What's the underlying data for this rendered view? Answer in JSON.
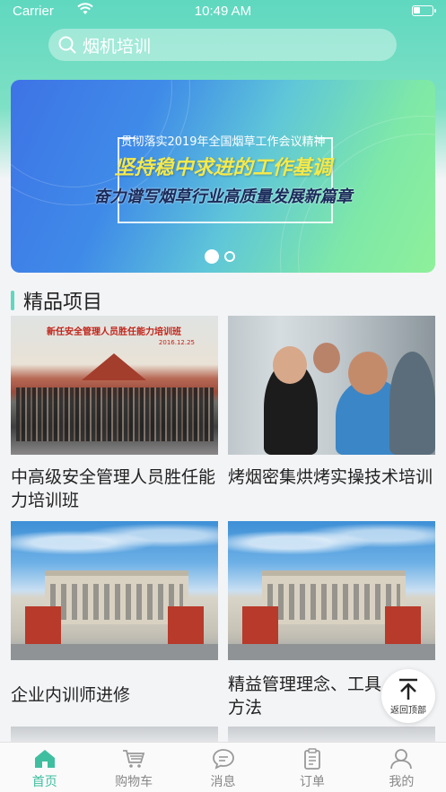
{
  "status_bar": {
    "carrier": "Carrier",
    "time": "10:49 AM"
  },
  "search": {
    "text": "烟机培训"
  },
  "banner": {
    "line1": "贯彻落实2019年全国烟草工作会议精神",
    "line2": "坚持稳中求进的工作基调",
    "line3": "奋力谱写烟草行业高质量发展新篇章",
    "page_count": 2,
    "active_page": 1
  },
  "section": {
    "title": "精品项目"
  },
  "cards": [
    {
      "name": "中高级安全管理人员胜任能力培训班",
      "banner_text": "新任安全管理人员胜任能力培训班",
      "date": "2016.12.25"
    },
    {
      "name": "烤烟密集烘烤实操技术培训"
    },
    {
      "name": "企业内训师进修"
    },
    {
      "name": "精益管理理念、工具方法"
    }
  ],
  "back_to_top": {
    "label": "返回顶部"
  },
  "tabbar": [
    {
      "label": "首页",
      "icon": "home-icon",
      "active": true
    },
    {
      "label": "购物车",
      "icon": "cart-icon",
      "active": false
    },
    {
      "label": "消息",
      "icon": "message-icon",
      "active": false
    },
    {
      "label": "订单",
      "icon": "order-icon",
      "active": false
    },
    {
      "label": "我的",
      "icon": "profile-icon",
      "active": false
    }
  ],
  "colors": {
    "accent": "#3fbf9f",
    "header": "#5fd8c0"
  }
}
